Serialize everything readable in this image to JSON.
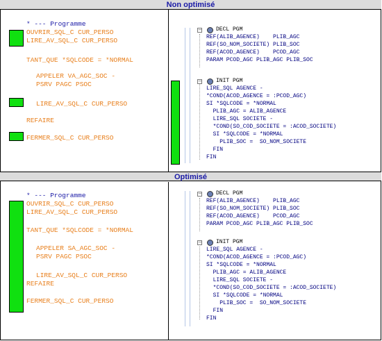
{
  "headers": {
    "top": "Non optimisé",
    "bottom": "Optimisé"
  },
  "left_top": [
    {
      "text": "* --- Programme",
      "color": "blue"
    },
    {
      "text": "OUVRIR_SQL_C CUR_PERSO",
      "color": "orange"
    },
    {
      "text": "LIRE_AV_SQL_C CUR_PERSO",
      "color": "orange"
    },
    {
      "text": "TANT_QUE *SQLCODE = *NORMAL",
      "color": "orange"
    },
    {
      "text": "APPELER VA_AGC_SOC -",
      "color": "orange"
    },
    {
      "text": "PSRV PAGC PSOC",
      "color": "orange"
    },
    {
      "text": "LIRE_AV_SQL_C CUR_PERSO",
      "color": "orange"
    },
    {
      "text": "REFAIRE",
      "color": "orange"
    },
    {
      "text": "FERMER_SQL_C CUR_PERSO",
      "color": "orange"
    }
  ],
  "left_bottom": [
    {
      "text": "* --- Programme",
      "color": "blue"
    },
    {
      "text": "OUVRIR_SQL_C CUR_PERSO",
      "color": "orange"
    },
    {
      "text": "LIRE_AV_SQL_C CUR_PERSO",
      "color": "orange"
    },
    {
      "text": "TANT_QUE *SQLCODE = *NORMAL",
      "color": "orange"
    },
    {
      "text": "APPELER SA_AGC_SOC -",
      "color": "orange"
    },
    {
      "text": "PSRV PAGC PSOC",
      "color": "orange"
    },
    {
      "text": "LIRE_AV_SQL_C CUR_PERSO",
      "color": "orange"
    },
    {
      "text": "REFAIRE",
      "color": "orange"
    },
    {
      "text": "FERMER_SQL_C CUR_PERSO",
      "color": "orange"
    }
  ],
  "decl_pgm": {
    "title": "DECL PGM",
    "lines": [
      "REF(ALIB_AGENCE)    PLIB_AGC",
      "REF(SO_NOM_SOCIETE) PLIB_SOC",
      "REF(ACOD_AGENCE)    PCOD_AGC",
      "PARAM PCOD_AGC PLIB_AGC PLIB_SOC"
    ]
  },
  "init_pgm": {
    "title": "INIT PGM",
    "lines": [
      "LIRE_SQL AGENCE -",
      "*COND(ACOD_AGENCE = :PCOD_AGC)",
      "SI *SQLCODE = *NORMAL",
      "  PLIB_AGC = ALIB_AGENCE",
      "  LIRE_SQL SOCIETE -",
      "  *COND(SO_COD_SOCIETE = :ACOD_SOCIETE)",
      "  SI *SQLCODE = *NORMAL",
      "    PLIB_SOC =  SO_NOM_SOCIETE",
      "  FIN",
      "FIN"
    ]
  },
  "colors": {
    "accent_green": "#10e010",
    "orange": "#e8801e",
    "blue": "#1a1aa6",
    "red": "#e0001a"
  }
}
